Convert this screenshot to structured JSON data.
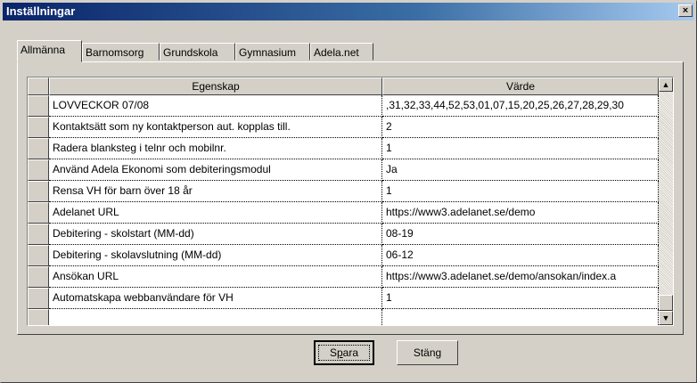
{
  "window": {
    "title": "Inställningar",
    "close_glyph": "×"
  },
  "tabs": [
    {
      "label": "Allmänna",
      "active": true
    },
    {
      "label": "Barnomsorg",
      "active": false
    },
    {
      "label": "Grundskola",
      "active": false
    },
    {
      "label": "Gymnasium",
      "active": false
    },
    {
      "label": "Adela.net",
      "active": false
    }
  ],
  "grid": {
    "columns": {
      "property": "Egenskap",
      "value": "Värde"
    },
    "rows": [
      {
        "property": "LOVVECKOR 07/08",
        "value": ",31,32,33,44,52,53,01,07,15,20,25,26,27,28,29,30"
      },
      {
        "property": "Kontaktsätt som ny kontaktperson aut. kopplas till.",
        "value": "2"
      },
      {
        "property": "Radera blanksteg i telnr och mobilnr.",
        "value": "1"
      },
      {
        "property": "Använd Adela Ekonomi som debiteringsmodul",
        "value": "Ja"
      },
      {
        "property": "Rensa VH för barn över 18 år",
        "value": "1"
      },
      {
        "property": "Adelanet URL",
        "value": "https://www3.adelanet.se/demo"
      },
      {
        "property": "Debitering - skolstart (MM-dd)",
        "value": "08-19"
      },
      {
        "property": "Debitering - skolavslutning (MM-dd)",
        "value": "06-12"
      },
      {
        "property": "Ansökan URL",
        "value": "https://www3.adelanet.se/demo/ansokan/index.a"
      },
      {
        "property": "Automatskapa webbanvändare för VH",
        "value": "1"
      },
      {
        "property": "",
        "value": ""
      }
    ],
    "scrollbar": {
      "up_glyph": "▲",
      "down_glyph": "▼"
    }
  },
  "buttons": {
    "save": {
      "label_pre": "S",
      "label_accel": "p",
      "label_post": "ara"
    },
    "close": {
      "label": "Stäng"
    }
  }
}
